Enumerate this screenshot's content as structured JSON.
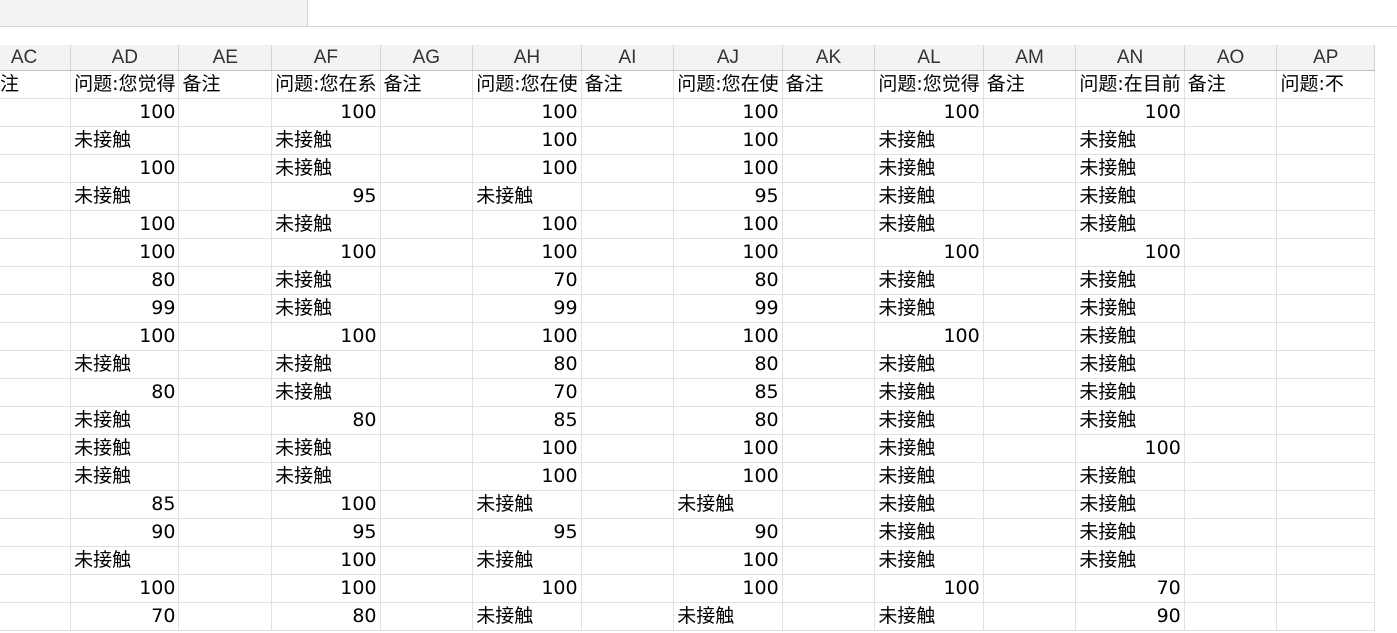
{
  "columns": [
    "AC",
    "AD",
    "AE",
    "AF",
    "AG",
    "AH",
    "AI",
    "AJ",
    "AK",
    "AL",
    "AM",
    "AN",
    "AO",
    "AP"
  ],
  "header_row": [
    "备注",
    "问题:您觉得",
    "备注",
    "问题:您在系",
    "备注",
    "问题:您在使",
    "备注",
    "问题:您在使",
    "备注",
    "问题:您觉得",
    "备注",
    "问题:在目前",
    "备注",
    "问题:不"
  ],
  "rows": [
    [
      "",
      "100",
      "",
      "100",
      "",
      "100",
      "",
      "100",
      "",
      "100",
      "",
      "100",
      "",
      ""
    ],
    [
      "",
      "未接触",
      "",
      "未接触",
      "",
      "100",
      "",
      "100",
      "",
      "未接触",
      "",
      "未接触",
      "",
      ""
    ],
    [
      "",
      "100",
      "",
      "未接触",
      "",
      "100",
      "",
      "100",
      "",
      "未接触",
      "",
      "未接触",
      "",
      ""
    ],
    [
      "",
      "未接触",
      "",
      "95",
      "",
      "未接触",
      "",
      "95",
      "",
      "未接触",
      "",
      "未接触",
      "",
      ""
    ],
    [
      "",
      "100",
      "",
      "未接触",
      "",
      "100",
      "",
      "100",
      "",
      "未接触",
      "",
      "未接触",
      "",
      ""
    ],
    [
      "",
      "100",
      "",
      "100",
      "",
      "100",
      "",
      "100",
      "",
      "100",
      "",
      "100",
      "",
      ""
    ],
    [
      "",
      "80",
      "",
      "未接触",
      "",
      "70",
      "",
      "80",
      "",
      "未接触",
      "",
      "未接触",
      "",
      ""
    ],
    [
      "",
      "99",
      "",
      "未接触",
      "",
      "99",
      "",
      "99",
      "",
      "未接触",
      "",
      "未接触",
      "",
      ""
    ],
    [
      "",
      "100",
      "",
      "100",
      "",
      "100",
      "",
      "100",
      "",
      "100",
      "",
      "未接触",
      "",
      ""
    ],
    [
      "",
      "未接触",
      "",
      "未接触",
      "",
      "80",
      "",
      "80",
      "",
      "未接触",
      "",
      "未接触",
      "",
      ""
    ],
    [
      "",
      "80",
      "",
      "未接触",
      "",
      "70",
      "",
      "85",
      "",
      "未接触",
      "",
      "未接触",
      "",
      ""
    ],
    [
      "",
      "未接触",
      "",
      "80",
      "",
      "85",
      "",
      "80",
      "",
      "未接触",
      "",
      "未接触",
      "",
      ""
    ],
    [
      "",
      "未接触",
      "",
      "未接触",
      "",
      "100",
      "",
      "100",
      "",
      "未接触",
      "",
      "100",
      "",
      ""
    ],
    [
      "",
      "未接触",
      "",
      "未接触",
      "",
      "100",
      "",
      "100",
      "",
      "未接触",
      "",
      "未接触",
      "",
      ""
    ],
    [
      "",
      "85",
      "",
      "100",
      "",
      "未接触",
      "",
      "未接触",
      "",
      "未接触",
      "",
      "未接触",
      "",
      ""
    ],
    [
      "",
      "90",
      "",
      "95",
      "",
      "95",
      "",
      "90",
      "",
      "未接触",
      "",
      "未接触",
      "",
      ""
    ],
    [
      "",
      "未接触",
      "",
      "100",
      "",
      "未接触",
      "",
      "100",
      "",
      "未接触",
      "",
      "未接触",
      "",
      ""
    ],
    [
      "",
      "100",
      "",
      "100",
      "",
      "100",
      "",
      "100",
      "",
      "100",
      "",
      "70",
      "",
      ""
    ],
    [
      "",
      "70",
      "",
      "80",
      "",
      "未接触",
      "",
      "未接触",
      "",
      "未接触",
      "",
      "90",
      "",
      ""
    ]
  ]
}
